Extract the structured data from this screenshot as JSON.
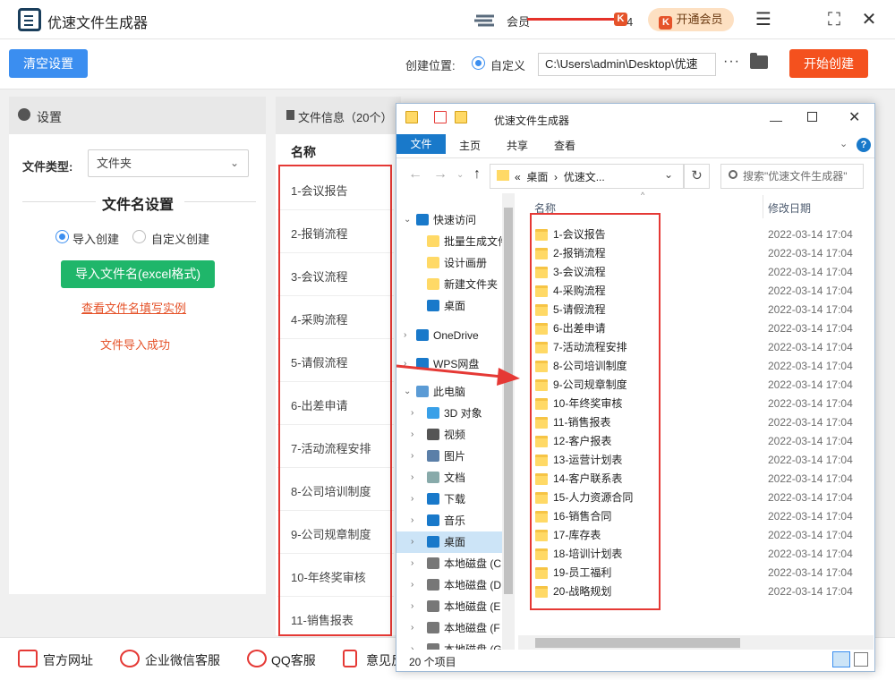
{
  "app": {
    "title": "优速文件生成器",
    "member_text": "会员",
    "member_suffix": "4",
    "vip_badge": "K",
    "vip_button": "开通会员"
  },
  "toolbar": {
    "clear_label": "清空设置",
    "location_label": "创建位置:",
    "custom_label": "自定义",
    "path_value": "C:\\Users\\admin\\Desktop\\优速",
    "more_label": "···",
    "start_label": "开始创建"
  },
  "settings": {
    "title": "设置",
    "file_type_label": "文件类型:",
    "file_type_value": "文件夹",
    "name_heading": "文件名设置",
    "radio_import": "导入创建",
    "radio_custom": "自定义创建",
    "import_button": "导入文件名(excel格式)",
    "example_link": "查看文件名填写实例",
    "import_status": "文件导入成功"
  },
  "file_info": {
    "title": "文件信息（20个）",
    "name_column": "名称",
    "rows": [
      "1-会议报告",
      "2-报销流程",
      "3-会议流程",
      "4-采购流程",
      "5-请假流程",
      "6-出差申请",
      "7-活动流程安排",
      "8-公司培训制度",
      "9-公司规章制度",
      "10-年终奖审核",
      "11-销售报表"
    ]
  },
  "bottom": {
    "website": "官方网址",
    "wechat": "企业微信客服",
    "qq": "QQ客服",
    "feedback": "意见反"
  },
  "explorer": {
    "title": "优速文件生成器",
    "tabs": [
      "文件",
      "主页",
      "共享",
      "查看"
    ],
    "address": [
      "«",
      "桌面",
      "›",
      "优速文..."
    ],
    "search_placeholder": "搜索\"优速文件生成器\"",
    "help": "?",
    "tree": [
      {
        "label": "快速访问",
        "icon": "star-icon"
      },
      {
        "label": "批量生成文件",
        "icon": "folder-icon"
      },
      {
        "label": "设计画册",
        "icon": "folder-icon"
      },
      {
        "label": "新建文件夹",
        "icon": "folder-icon"
      },
      {
        "label": "桌面",
        "icon": "desktop-icon"
      },
      {
        "label": "OneDrive",
        "icon": "cloud-icon"
      },
      {
        "label": "WPS网盘",
        "icon": "cloud-icon"
      },
      {
        "label": "此电脑",
        "icon": "computer-icon"
      },
      {
        "label": "3D 对象",
        "icon": "cube-icon"
      },
      {
        "label": "视频",
        "icon": "video-icon"
      },
      {
        "label": "图片",
        "icon": "picture-icon"
      },
      {
        "label": "文档",
        "icon": "document-icon"
      },
      {
        "label": "下载",
        "icon": "download-icon"
      },
      {
        "label": "音乐",
        "icon": "music-icon"
      },
      {
        "label": "桌面",
        "icon": "desktop-icon"
      },
      {
        "label": "本地磁盘 (C",
        "icon": "drive-icon"
      },
      {
        "label": "本地磁盘 (D",
        "icon": "drive-icon"
      },
      {
        "label": "本地磁盘 (E",
        "icon": "drive-icon"
      },
      {
        "label": "本地磁盘 (F",
        "icon": "drive-icon"
      },
      {
        "label": "本地磁盘 (G",
        "icon": "drive-icon"
      }
    ],
    "col_name": "名称",
    "col_date": "修改日期",
    "files": [
      {
        "name": "1-会议报告",
        "date": "2022-03-14 17:04"
      },
      {
        "name": "2-报销流程",
        "date": "2022-03-14 17:04"
      },
      {
        "name": "3-会议流程",
        "date": "2022-03-14 17:04"
      },
      {
        "name": "4-采购流程",
        "date": "2022-03-14 17:04"
      },
      {
        "name": "5-请假流程",
        "date": "2022-03-14 17:04"
      },
      {
        "name": "6-出差申请",
        "date": "2022-03-14 17:04"
      },
      {
        "name": "7-活动流程安排",
        "date": "2022-03-14 17:04"
      },
      {
        "name": "8-公司培训制度",
        "date": "2022-03-14 17:04"
      },
      {
        "name": "9-公司规章制度",
        "date": "2022-03-14 17:04"
      },
      {
        "name": "10-年终奖审核",
        "date": "2022-03-14 17:04"
      },
      {
        "name": "11-销售报表",
        "date": "2022-03-14 17:04"
      },
      {
        "name": "12-客户报表",
        "date": "2022-03-14 17:04"
      },
      {
        "name": "13-运营计划表",
        "date": "2022-03-14 17:04"
      },
      {
        "name": "14-客户联系表",
        "date": "2022-03-14 17:04"
      },
      {
        "name": "15-人力资源合同",
        "date": "2022-03-14 17:04"
      },
      {
        "name": "16-销售合同",
        "date": "2022-03-14 17:04"
      },
      {
        "name": "17-库存表",
        "date": "2022-03-14 17:04"
      },
      {
        "name": "18-培训计划表",
        "date": "2022-03-14 17:04"
      },
      {
        "name": "19-员工福利",
        "date": "2022-03-14 17:04"
      },
      {
        "name": "20-战略规划",
        "date": "2022-03-14 17:04"
      }
    ],
    "status": "20 个项目"
  },
  "colors": {
    "accent_blue": "#3b8ef0",
    "start_orange": "#f4511e",
    "import_green": "#1fb66a",
    "annotation_red": "#e53935",
    "folder_yellow": "#ffd966"
  }
}
